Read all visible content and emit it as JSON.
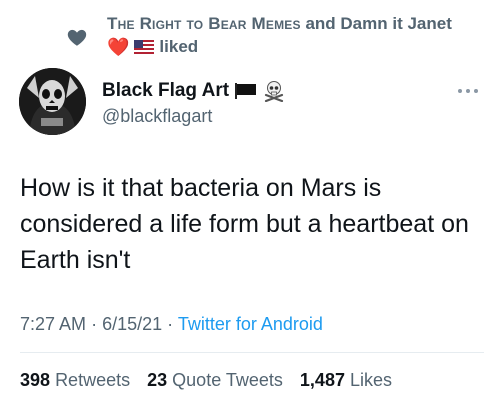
{
  "social_context": {
    "line1_caps": "The Right to Bear Memes",
    "line1_rest": "and Damn it Janet",
    "line2_heart": "❤️",
    "line2_label": "liked"
  },
  "author": {
    "name": "Black Flag Art",
    "handle": "@blackflagart"
  },
  "tweet": {
    "text": "How is it that bacteria on Mars is considered a life form but a heartbeat on Earth isn't"
  },
  "meta": {
    "time": "7:27 AM",
    "separator": "·",
    "date": "6/15/21",
    "source": "Twitter for Android"
  },
  "stats": {
    "retweets_count": "398",
    "retweets_label": "Retweets",
    "quotes_count": "23",
    "quotes_label": "Quote Tweets",
    "likes_count": "1,487",
    "likes_label": "Likes"
  },
  "colors": {
    "text_primary": "#0f1419",
    "text_secondary": "#536471",
    "accent": "#1d9bf0",
    "heart": "#e0245e"
  }
}
